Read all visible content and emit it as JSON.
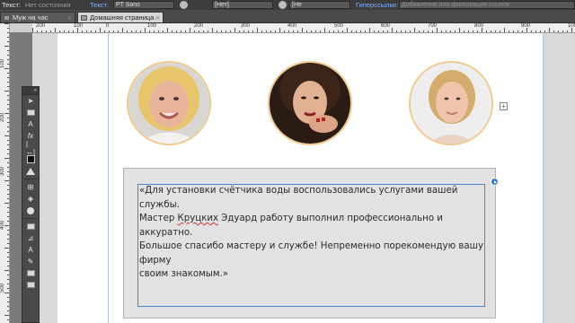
{
  "toolbar": {
    "text_label": "Текст:",
    "text_state": "Нет состояния",
    "text_label2": "Текст:",
    "font": "PT Sans",
    "none1": "[Нет]",
    "none2": "[Не",
    "hyperlinks_label": "Гиперссылки:",
    "hyperlinks_hint": "Добавление или фильтрация ссылок"
  },
  "tabs": [
    {
      "label": "Муж на час",
      "active": false
    },
    {
      "label": "Домашняя страница",
      "active": true
    }
  ],
  "ruler": {
    "top_labels": [
      "200",
      "100",
      "0",
      "100",
      "200",
      "300",
      "400",
      "500",
      "600",
      "700",
      "800",
      "900",
      "1000"
    ],
    "left_labels": [
      "100",
      "200",
      "300",
      "400",
      "500"
    ]
  },
  "tools": [
    "selection-tool",
    "direct-select-tool",
    "text-tool",
    "function-tool",
    "spacing-tool",
    "widget-tool",
    "rectangle-tool",
    "ellipse-tool",
    "frame-tool",
    "image-tool",
    "hand-tool",
    "zoom-tool",
    "pencil-tool",
    "brush-tool",
    "swatch-tool",
    "layers-tool"
  ],
  "avatars": [
    {
      "description": "portrait-blonde-woman-smiling"
    },
    {
      "description": "portrait-dark-haired-woman"
    },
    {
      "description": "portrait-young-blonde-woman"
    }
  ],
  "testimonial": {
    "line1": "«Для установки счётчика воды воспользовались услугами вашей службы.",
    "line2_a": "Мастер ",
    "line2_spell": "Круцких",
    "line2_b": " Эдуард работу выполнил профессионально и аккуратно.",
    "line3": "Большое спасибо мастеру и службе! Непременно порекомендую вашу фирму",
    "line4": "своим знакомым.»"
  },
  "colors": {
    "avatar_border": "#f0c98f",
    "frame_blue": "#4a86d6",
    "guide_blue": "#a9c6e8"
  }
}
